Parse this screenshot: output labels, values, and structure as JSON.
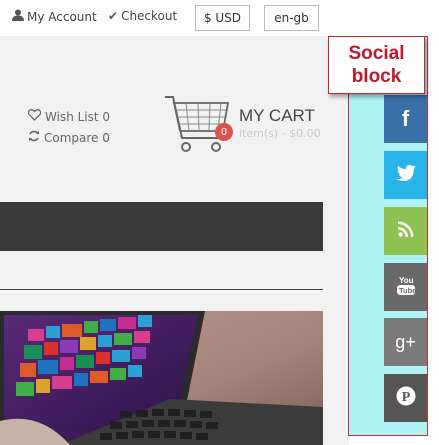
{
  "topbar": {
    "account_label": "My Account",
    "checkout_label": "Checkout",
    "currency_label": "$ USD",
    "language_label": "en-gb"
  },
  "callout": {
    "line1": "Social",
    "line2": "block"
  },
  "header": {
    "wishlist_label": "Wish List 0",
    "compare_label": "Compare 0"
  },
  "cart": {
    "title": "MY CART",
    "summary": "item(s) - $0.00",
    "count": "0"
  },
  "social": {
    "buttons": [
      {
        "icon": "facebook-icon",
        "glyph": "f",
        "color": "#3b6fa8"
      },
      {
        "icon": "twitter-icon",
        "glyph": "🐦",
        "color": "#28b4e8"
      },
      {
        "icon": "rss-icon",
        "glyph": "◗",
        "color": "#8fc252"
      },
      {
        "icon": "youtube-icon",
        "glyph": "You Tube",
        "color": "#6a6a6a"
      },
      {
        "icon": "google-plus-icon",
        "glyph": "g+",
        "color": "#6a6a6a"
      },
      {
        "icon": "pinterest-icon",
        "glyph": "P",
        "color": "#555555"
      }
    ]
  },
  "colors": {
    "panel_bg": "#aff3f7",
    "callout_text": "#c0182a",
    "navbar_bg": "#3a3a3a",
    "badge_bg": "#d9534f"
  }
}
